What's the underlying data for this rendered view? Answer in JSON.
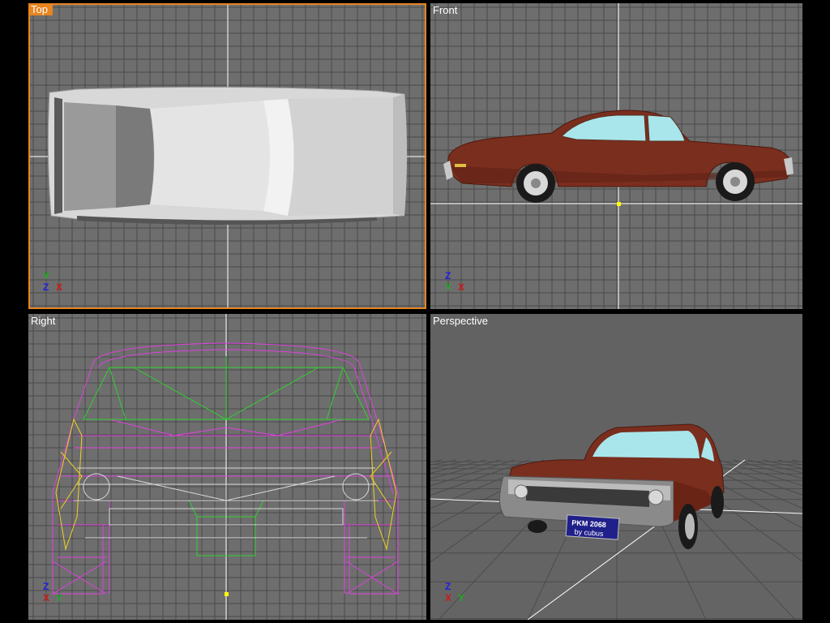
{
  "viewports": {
    "top": {
      "label": "Top",
      "active": true,
      "axes": [
        "Y",
        "Z",
        "X"
      ]
    },
    "front": {
      "label": "Front",
      "active": false,
      "axes": [
        "Z",
        "Y",
        "X"
      ]
    },
    "right": {
      "label": "Right",
      "active": false,
      "axes": [
        "Z",
        "X",
        "Y"
      ]
    },
    "perspective": {
      "label": "Perspective",
      "active": false,
      "axes": [
        "Z",
        "X",
        "Y"
      ]
    }
  },
  "license_plate": {
    "line1": "PKM 2068",
    "line2": "by cubus"
  },
  "colors": {
    "viewport_bg": "#6e6e6e",
    "grid_line": "#4a4a4a",
    "active_border": "#e9841f",
    "car_body": "#7a2e1e",
    "car_glass": "#9fe0e6",
    "wire_magenta": "#e040e0",
    "wire_green": "#30d030",
    "wire_yellow": "#f0d020"
  }
}
